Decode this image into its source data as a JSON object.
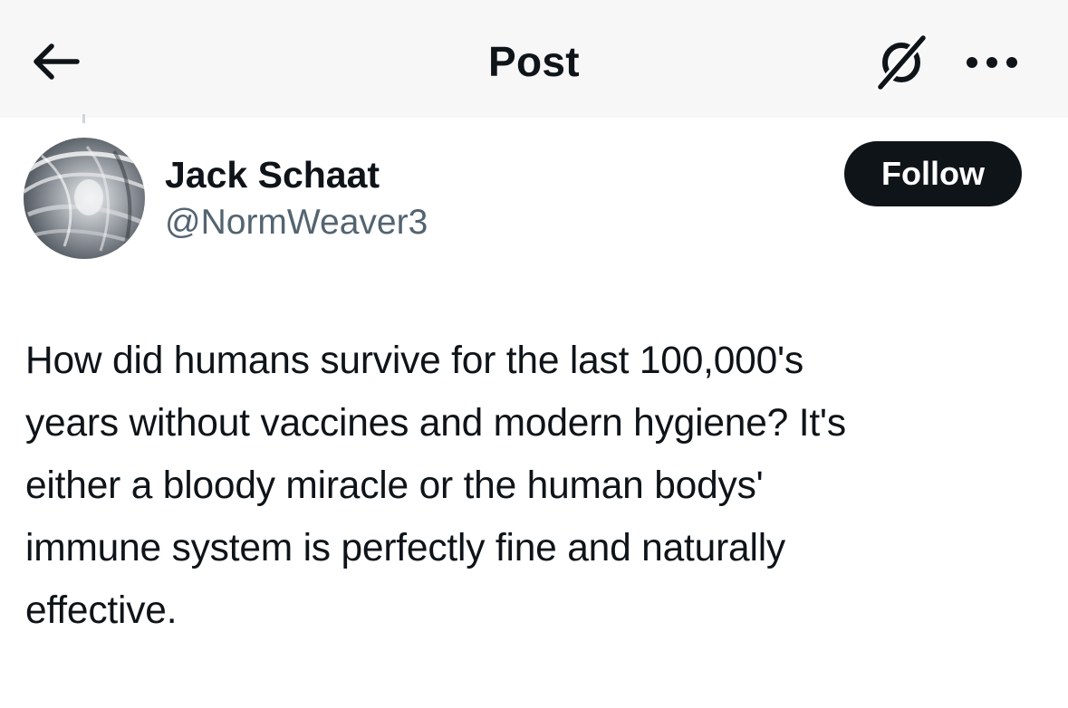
{
  "header": {
    "title": "Post",
    "back_icon": "arrow-left-icon",
    "grok_icon": "grok-slash-icon",
    "more_icon": "more-horizontal-icon"
  },
  "author": {
    "display_name": "Jack Schaat",
    "handle": "@NormWeaver3",
    "follow_label": "Follow"
  },
  "post": {
    "text": "How did humans survive for the last 100,000's\nyears without vaccines and modern hygiene? It's\neither a bloody miracle or the human bodys'\nimmune system is perfectly fine and naturally\neffective."
  },
  "colors": {
    "text_primary": "#0f1419",
    "text_secondary": "#536471",
    "follow_bg": "#0f1419",
    "header_bg": "#f7f7f8"
  }
}
